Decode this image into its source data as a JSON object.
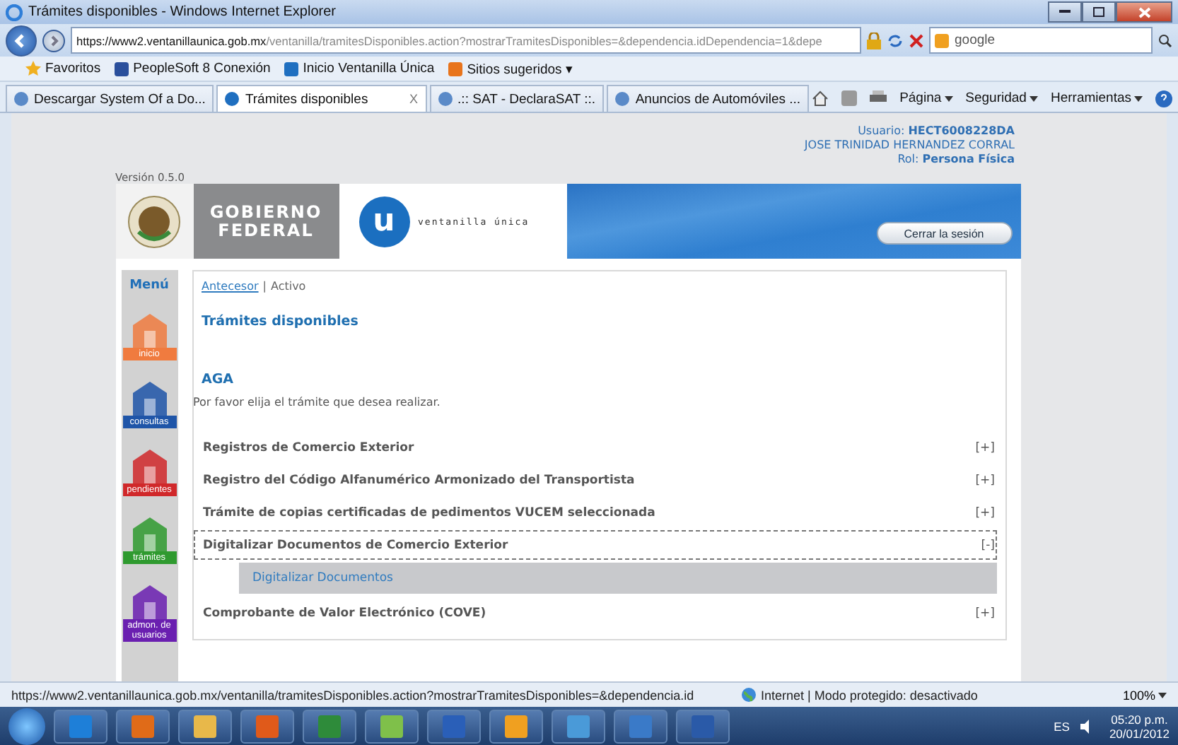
{
  "window": {
    "title": "Trámites disponibles - Windows Internet Explorer"
  },
  "address_bar": {
    "url_host": "https://www2.ventanillaunica.gob.mx",
    "url_path": "/ventanilla/tramitesDisponibles.action?mostrarTramitesDisponibles=&dependencia.idDependencia=1&depe",
    "search_value": "google"
  },
  "favorites_bar": {
    "label": "Favoritos",
    "items": [
      {
        "label": "PeopleSoft 8 Conexión",
        "color": "#2a4f9c"
      },
      {
        "label": "Inicio Ventanilla Única",
        "color": "#1f6fc0"
      },
      {
        "label": "Sitios sugeridos ▾",
        "color": "#e8741c"
      }
    ]
  },
  "tabs": [
    {
      "label": "Descargar System Of a Do...",
      "selected": false
    },
    {
      "label": "Trámites disponibles",
      "selected": true
    },
    {
      "label": ".:: SAT - DeclaraSAT ::.",
      "selected": false
    },
    {
      "label": "Anuncios de Automóviles ...",
      "selected": false
    }
  ],
  "tab_close": "X",
  "command_bar": [
    "Página",
    "Seguridad",
    "Herramientas"
  ],
  "page": {
    "user_lines": [
      "Usuario: **HECT6008228DA**",
      "JOSE TRINIDAD HERNANDEZ CORRAL",
      "Rol: **Persona Física**"
    ],
    "version": "Versión 0.5.0",
    "banner": {
      "gov_lines": [
        "GOBIERNO",
        "FEDERAL"
      ],
      "logo_letter": "u",
      "logo_text": "ventanilla única",
      "logout": "Cerrar la sesión"
    },
    "menu": {
      "title": "Menú",
      "items": [
        {
          "label": "inicio",
          "color": "#f07b3f"
        },
        {
          "label": "consultas",
          "color": "#1f55a8"
        },
        {
          "label": "pendientes",
          "color": "#d0282a"
        },
        {
          "label": "trámites",
          "color": "#2f9a2f"
        },
        {
          "label": "admon. de usuarios",
          "color": "#6a1fb0"
        }
      ]
    },
    "breadcrumb": {
      "link": "Antecesor",
      "separator": "|",
      "current": "Activo"
    },
    "heading": "Trámites disponibles",
    "section": "AGA",
    "instruction": "Por favor elija el trámite que desea realizar.",
    "procedures": [
      {
        "label": "Registros de Comercio Exterior",
        "toggle": "[+]",
        "expanded": false
      },
      {
        "label": "Registro del Código Alfanumérico Armonizado del Transportista",
        "toggle": "[+]",
        "expanded": false
      },
      {
        "label": "Trámite de copias certificadas de pedimentos VUCEM seleccionada",
        "toggle": "[+]",
        "expanded": false
      },
      {
        "label": "Digitalizar Documentos de Comercio Exterior",
        "toggle": "[-]",
        "expanded": true,
        "children": [
          {
            "label": "Digitalizar Documentos"
          }
        ]
      },
      {
        "label": "Comprobante de Valor Electrónico (COVE)",
        "toggle": "[+]",
        "expanded": false
      }
    ]
  },
  "status_bar": {
    "url": "https://www2.ventanillaunica.gob.mx/ventanilla/tramitesDisponibles.action?mostrarTramitesDisponibles=&dependencia.id",
    "zone": "Internet | Modo protegido: desactivado",
    "zoom": "100%"
  },
  "taskbar": {
    "language": "ES",
    "time": "05:20 p.m.",
    "date": "20/01/2012",
    "apps": [
      {
        "color": "#1e7fd8"
      },
      {
        "color": "#e06b18"
      },
      {
        "color": "#e8b84a"
      },
      {
        "color": "#e05a1a"
      },
      {
        "color": "#2e8b3a"
      },
      {
        "color": "#7fc04a"
      },
      {
        "color": "#2a5fb8"
      },
      {
        "color": "#f0a020"
      },
      {
        "color": "#4a9ad8"
      },
      {
        "color": "#3a7ac8"
      },
      {
        "color": "#2a5aa8"
      }
    ]
  }
}
